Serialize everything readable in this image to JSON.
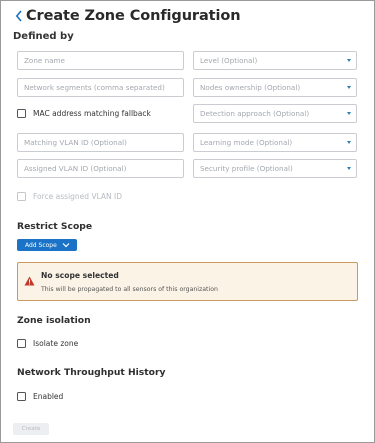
{
  "header": {
    "title": "Create Zone Configuration"
  },
  "defined_by": {
    "label": "Defined by"
  },
  "fields": {
    "zone_name": {
      "placeholder": "Zone name",
      "value": ""
    },
    "level": {
      "placeholder": "Level (Optional)"
    },
    "network_segments": {
      "placeholder": "Network segments (comma separated)",
      "value": ""
    },
    "nodes_ownership": {
      "placeholder": "Nodes ownership (Optional)"
    },
    "mac_fallback": {
      "label": "MAC address matching fallback",
      "checked": false
    },
    "detection_approach": {
      "placeholder": "Detection approach (Optional)"
    },
    "matching_vlan": {
      "placeholder": "Matching VLAN ID (Optional)",
      "value": ""
    },
    "learning_mode": {
      "placeholder": "Learning mode (Optional)"
    },
    "assigned_vlan": {
      "placeholder": "Assigned VLAN ID (Optional)",
      "value": ""
    },
    "security_profile": {
      "placeholder": "Security profile (Optional)"
    },
    "force_assigned_vlan": {
      "label": "Force assigned VLAN ID",
      "checked": false,
      "disabled": true
    }
  },
  "restrict_scope": {
    "title": "Restrict Scope",
    "add_scope_label": "Add Scope",
    "alert": {
      "title": "No scope selected",
      "message": "This will be propagated to all sensors of this organization"
    }
  },
  "zone_isolation": {
    "title": "Zone isolation",
    "isolate_label": "Isolate zone",
    "checked": false
  },
  "throughput_history": {
    "title": "Network Throughput History",
    "enabled_label": "Enabled",
    "checked": false
  },
  "create_button": {
    "label": "Create",
    "disabled": true
  },
  "icons": {
    "back": "chevron-left-icon",
    "caret": "caret-down-icon",
    "warning": "warning-icon",
    "add_scope_chevron": "chevron-down-icon"
  },
  "colors": {
    "accent": "#1a73c6",
    "warning_border": "#c99b5e",
    "warning_bg": "#fbf3e6",
    "warning_icon": "#c0392b"
  }
}
